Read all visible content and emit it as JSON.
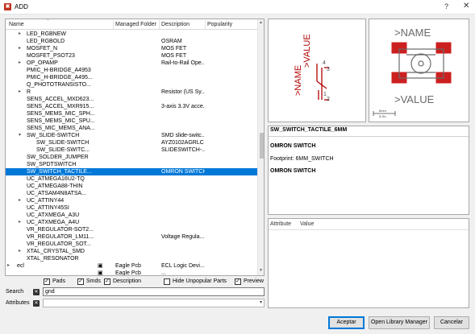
{
  "window": {
    "title": "ADD",
    "help": "?",
    "close": "✕"
  },
  "tree": {
    "columns": [
      "Name",
      "Managed Folder",
      "Description",
      "Popularity"
    ],
    "rows": [
      {
        "name": "LED_RGBNEW",
        "level": 1,
        "expander": "▸",
        "folder": "",
        "desc": ""
      },
      {
        "name": "LED_RGBOLD",
        "level": 1,
        "expander": "",
        "folder": "",
        "desc": "OSRAM"
      },
      {
        "name": "MOSFET_N",
        "level": 1,
        "expander": "▸",
        "folder": "",
        "desc": "MOS FET"
      },
      {
        "name": "MOSFET_PSOT23",
        "level": 1,
        "expander": "",
        "folder": "",
        "desc": "MOS FET"
      },
      {
        "name": "OP_OPAMP",
        "level": 1,
        "expander": "▸",
        "folder": "",
        "desc": "Rail-to-Rail Ope..."
      },
      {
        "name": "PMIC_H-BRIDGE_A4953",
        "level": 1,
        "expander": "",
        "folder": "",
        "desc": ""
      },
      {
        "name": "PMIC_H-BRIDGE_A495...",
        "level": 1,
        "expander": "",
        "folder": "",
        "desc": ""
      },
      {
        "name": "Q_PHOTOTRANSISTO...",
        "level": 1,
        "expander": "",
        "folder": "",
        "desc": ""
      },
      {
        "name": "R",
        "level": 1,
        "expander": "▸",
        "folder": "",
        "desc": "Resistor (US Sy..."
      },
      {
        "name": "SENS_ACCEL_MXD623...",
        "level": 1,
        "expander": "",
        "folder": "",
        "desc": ""
      },
      {
        "name": "SENS_ACCEL_MXR915...",
        "level": 1,
        "expander": "",
        "folder": "",
        "desc": "3-axis 3.3V acce..."
      },
      {
        "name": "SENS_MEMS_MIC_SPH...",
        "level": 1,
        "expander": "",
        "folder": "",
        "desc": ""
      },
      {
        "name": "SENS_MEMS_MIC_SPU...",
        "level": 1,
        "expander": "",
        "folder": "",
        "desc": ""
      },
      {
        "name": "SENS_MIC_MEMS_ANA...",
        "level": 1,
        "expander": "",
        "folder": "",
        "desc": ""
      },
      {
        "name": "SW_SLIDE-SWITCH",
        "level": 1,
        "expander": "▾",
        "folder": "",
        "desc": "SMD slide-switc..."
      },
      {
        "name": "SW_SLIDE-SWITCH",
        "level": 2,
        "expander": "",
        "folder": "",
        "desc": "AYZ0102AGRLC"
      },
      {
        "name": "SW_SLIDE-SWITC...",
        "level": 2,
        "expander": "",
        "folder": "",
        "desc": "SLIDESWITCH-..."
      },
      {
        "name": "SW_SOLDER_JUMPER",
        "level": 1,
        "expander": "",
        "folder": "",
        "desc": ""
      },
      {
        "name": "SW_SPDTSWITCH",
        "level": 1,
        "expander": "",
        "folder": "",
        "desc": ""
      },
      {
        "name": "SW_SWITCH_TACTILE...",
        "level": 1,
        "expander": "",
        "folder": "",
        "desc": "OMRON SWITCH",
        "selected": true
      },
      {
        "name": "UC_ATMEGA16U2-TQ",
        "level": 1,
        "expander": "",
        "folder": "",
        "desc": ""
      },
      {
        "name": "UC_ATMEGA88-THIN",
        "level": 1,
        "expander": "",
        "folder": "",
        "desc": ""
      },
      {
        "name": "UC_ATSAM4N8ATSA...",
        "level": 1,
        "expander": "",
        "folder": "",
        "desc": ""
      },
      {
        "name": "UC_ATTINY44",
        "level": 1,
        "expander": "▸",
        "folder": "",
        "desc": ""
      },
      {
        "name": "UC_ATTINY45SI",
        "level": 1,
        "expander": "",
        "folder": "",
        "desc": ""
      },
      {
        "name": "UC_ATXMEGA_A3U",
        "level": 1,
        "expander": "",
        "folder": "",
        "desc": ""
      },
      {
        "name": "UC_ATXMEGA_A4U",
        "level": 1,
        "expander": "▸",
        "folder": "",
        "desc": ""
      },
      {
        "name": "VR_REGULATOR-SOT2...",
        "level": 1,
        "expander": "",
        "folder": "",
        "desc": ""
      },
      {
        "name": "VR_REGULATOR_LM11...",
        "level": 1,
        "expander": "",
        "folder": "",
        "desc": "Voltage Regula..."
      },
      {
        "name": "VR_REGULATOR_SOT...",
        "level": 1,
        "expander": "",
        "folder": "",
        "desc": ""
      },
      {
        "name": "XTAL_CRYSTAL_SMD",
        "level": 1,
        "expander": "▸",
        "folder": "",
        "desc": ""
      },
      {
        "name": "XTAL_RESONATOR",
        "level": 1,
        "expander": "",
        "folder": "",
        "desc": ""
      },
      {
        "name": "ecl",
        "level": 0,
        "expander": "▸",
        "folder": "Eagle Pcb",
        "desc": "ECL Logic Devi..."
      },
      {
        "name": "",
        "level": 0,
        "expander": "",
        "folder": "Eagle Pcb",
        "desc": "..."
      }
    ]
  },
  "filters": {
    "pads": {
      "label": "Pads",
      "checked": true
    },
    "smds": {
      "label": "Smds",
      "checked": true
    },
    "description": {
      "label": "Description",
      "checked": true
    },
    "hide_unpopular": {
      "label": "Hide Unpopular Parts",
      "checked": false
    },
    "preview": {
      "label": "Preview",
      "checked": true
    }
  },
  "search": {
    "label": "Search",
    "value": "gnd"
  },
  "attributes": {
    "label": "Attributes",
    "value": ""
  },
  "preview": {
    "symbol": {
      "value_label": ">VALUE",
      "name_label": ">NAME",
      "pin1": "1",
      "pin2": "2",
      "pin3": "3",
      "pin4": "4"
    },
    "package": {
      "name_label": ">NAME",
      "value_label": ">VALUE",
      "scale_a": "6mm",
      "scale_b": "5.2in"
    }
  },
  "details": {
    "title": "SW_SWITCH_TACTILE_6MM",
    "desc": "OMRON SWITCH",
    "footprint": "Footprint: 6MM_SWITCH",
    "desc2": "OMRON SWITCH"
  },
  "attr_table": {
    "col_attr": "Attribute",
    "col_value": "Value"
  },
  "buttons": {
    "accept": "Aceptar",
    "open_lib": "Open Library Manager",
    "cancel": "Cancelar"
  },
  "colors": {
    "selection": "#0078d7",
    "pad_red": "#cc1f1f",
    "symbol_red": "#b00000"
  }
}
